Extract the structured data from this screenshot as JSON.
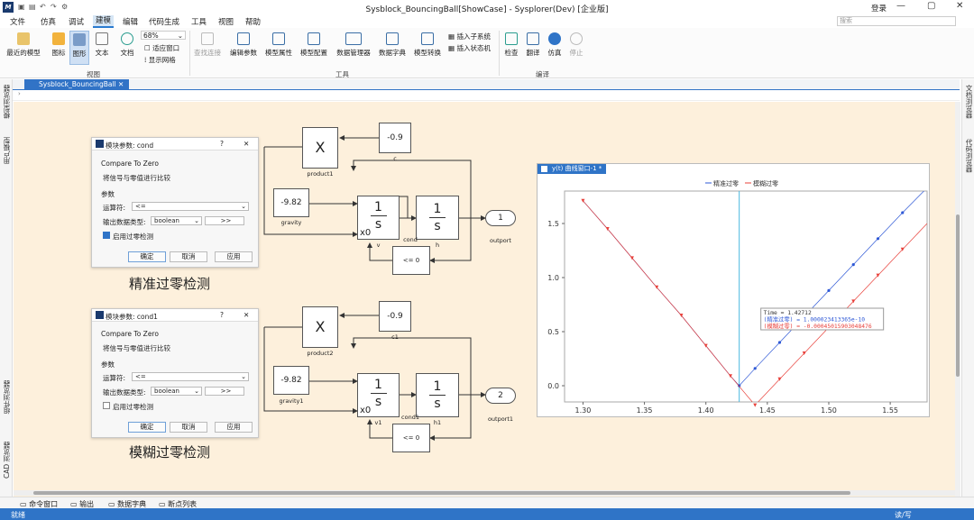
{
  "window": {
    "title": "Sysblock_BouncingBall[ShowCase] - Sysplorer(Dev) [企业版]",
    "login": "登录",
    "search_placeholder": "搜索"
  },
  "menu": [
    "文件",
    "仿真",
    "调试",
    "建模",
    "编辑",
    "代码生成",
    "工具",
    "视图",
    "帮助"
  ],
  "ribbon": {
    "recent_models": "最近的模型",
    "icon": "图标",
    "graphic": "图形",
    "text": "文本",
    "doc": "文档",
    "zoom": "68%",
    "fit_window": "适应窗口",
    "show_grid": "显示网格",
    "find_conn": "查找连接",
    "edit_params": "编辑参数",
    "model_props": "模型属性",
    "model_config": "模型配置",
    "data_manager": "数据管理器",
    "data_dict": "数据字典",
    "model_convert": "模型转换",
    "insert_subsystem": "插入子系统",
    "insert_statemachine": "插入状态机",
    "check": "检查",
    "translate": "翻译",
    "simulate": "仿真",
    "stop": "停止",
    "group_view": "视图",
    "group_tools": "工具",
    "group_compile": "编译"
  },
  "doc_tab": "Sysblock_BouncingBall",
  "left_dock": [
    "模型浏览器",
    "用户模型",
    "组件浏览器",
    "CAD 浏览器"
  ],
  "right_dock": [
    "文档浏览器",
    "代码浏览器"
  ],
  "dialogs": [
    {
      "title": "模块参数: cond",
      "help": "?",
      "close": "✕",
      "type_name": "Compare To Zero",
      "desc": "将信号与零值进行比较",
      "section": "参数",
      "op_label": "运算符:",
      "op_value": "<=",
      "dtype_label": "输出数据类型:",
      "dtype_value": "boolean",
      "more": ">>",
      "zc_label": "启用过零检测",
      "zc_checked": true,
      "ok": "确定",
      "cancel": "取消",
      "apply": "应用"
    },
    {
      "title": "模块参数: cond1",
      "help": "?",
      "close": "✕",
      "type_name": "Compare To Zero",
      "desc": "将信号与零值进行比较",
      "section": "参数",
      "op_label": "运算符:",
      "op_value": "<=",
      "dtype_label": "输出数据类型:",
      "dtype_value": "boolean",
      "more": ">>",
      "zc_label": "启用过零检测",
      "zc_checked": false,
      "ok": "确定",
      "cancel": "取消",
      "apply": "应用"
    }
  ],
  "captions": {
    "precise": "精准过零检测",
    "fuzzy": "模糊过零检测"
  },
  "diagram1": {
    "product": "X",
    "product_name": "product1",
    "c_value": "-0.9",
    "c_name": "c",
    "gravity_value": "-9.82",
    "gravity_name": "gravity",
    "int1_num": "1",
    "int1_den": "s",
    "int1_x0": "x0",
    "int1_name": "v",
    "int2_num": "1",
    "int2_den": "s",
    "int2_name": "h",
    "cmp_value": "<= 0",
    "cmp_name": "cond",
    "out_value": "1",
    "out_name": "outport"
  },
  "diagram2": {
    "product": "X",
    "product_name": "product2",
    "c_value": "-0.9",
    "c_name": "c1",
    "gravity_value": "-9.82",
    "gravity_name": "gravity1",
    "int1_num": "1",
    "int1_den": "s",
    "int1_x0": "x0",
    "int1_name": "v1",
    "int2_num": "1",
    "int2_den": "s",
    "int2_name": "h1",
    "cmp_value": "<= 0",
    "cmp_name": "cond1",
    "out_value": "2",
    "out_name": "outport1"
  },
  "plot_window": {
    "tab": "y(t) 曲线窗口-1 *",
    "tooltip": {
      "time": "Time = 1.42712",
      "precise": "(精准过零) = 1.000023413365e-10",
      "fuzzy": "(模糊过零) = -0.00045015903048476"
    }
  },
  "chart_data": {
    "type": "line",
    "title": "",
    "xlabel": "",
    "ylabel": "",
    "xlim": [
      1.285,
      1.58
    ],
    "ylim": [
      -0.15,
      1.8
    ],
    "xticks": [
      1.3,
      1.35,
      1.4,
      1.45,
      1.5,
      1.55
    ],
    "yticks": [
      0.0,
      0.5,
      1.0,
      1.5
    ],
    "legend_position": "top-center",
    "cursor_x": 1.42712,
    "series": [
      {
        "name": "精准过零",
        "color": "#2e58d6",
        "marker": "dot",
        "x": [
          1.3,
          1.32,
          1.34,
          1.36,
          1.38,
          1.4,
          1.42,
          1.42712,
          1.44,
          1.46,
          1.48,
          1.5,
          1.52,
          1.54,
          1.56,
          1.58
        ],
        "y": [
          1.71,
          1.45,
          1.18,
          0.91,
          0.65,
          0.37,
          0.09,
          0.0,
          0.16,
          0.4,
          0.64,
          0.88,
          1.12,
          1.36,
          1.6,
          1.83
        ],
        "marker_x": [
          1.42712,
          1.44,
          1.46,
          1.48,
          1.5,
          1.52,
          1.54,
          1.56
        ]
      },
      {
        "name": "模糊过零",
        "color": "#e8403a",
        "marker": "triangle",
        "x": [
          1.3,
          1.32,
          1.34,
          1.36,
          1.38,
          1.4,
          1.42,
          1.44,
          1.46,
          1.48,
          1.5,
          1.52,
          1.54,
          1.56,
          1.58
        ],
        "y": [
          1.71,
          1.45,
          1.18,
          0.91,
          0.65,
          0.37,
          0.09,
          -0.18,
          0.06,
          0.3,
          0.54,
          0.78,
          1.02,
          1.26,
          1.5
        ],
        "marker_x": [
          1.3,
          1.32,
          1.34,
          1.36,
          1.38,
          1.4,
          1.42,
          1.44,
          1.46,
          1.48,
          1.5,
          1.52,
          1.54,
          1.56
        ]
      }
    ]
  },
  "bottom_tabs": [
    "命令窗口",
    "输出",
    "数据字典",
    "断点列表"
  ],
  "status": {
    "left": "就绪",
    "right": "读/写"
  }
}
